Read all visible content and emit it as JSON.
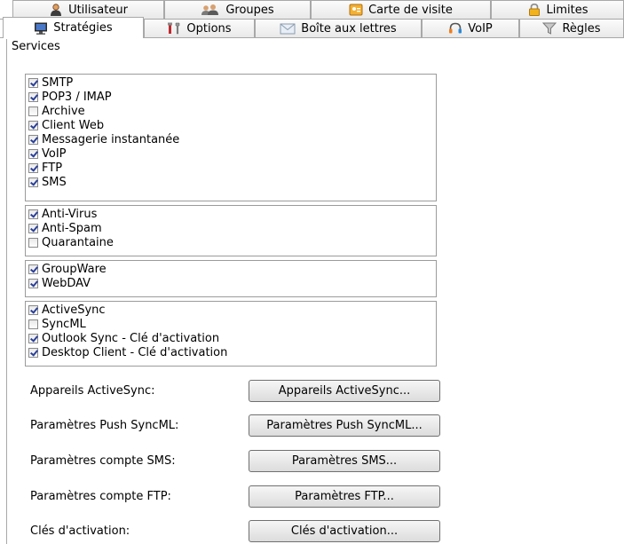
{
  "tabs_back": [
    {
      "label": "Utilisateur",
      "icon": "user-icon"
    },
    {
      "label": "Groupes",
      "icon": "groups-icon"
    },
    {
      "label": "Carte de visite",
      "icon": "business-card-icon"
    },
    {
      "label": "Limites",
      "icon": "lock-icon"
    }
  ],
  "tabs_front": [
    {
      "label": "Stratégies",
      "icon": "monitor-icon",
      "active": true
    },
    {
      "label": "Options",
      "icon": "tools-icon"
    },
    {
      "label": "Boîte aux lettres",
      "icon": "mail-icon"
    },
    {
      "label": "VoIP",
      "icon": "headset-icon"
    },
    {
      "label": "Règles",
      "icon": "filter-icon"
    }
  ],
  "services": {
    "label": "Services",
    "groups": [
      [
        {
          "label": "SMTP",
          "checked": true
        },
        {
          "label": "POP3 / IMAP",
          "checked": true
        },
        {
          "label": "Archive",
          "checked": false
        },
        {
          "label": "Client Web",
          "checked": true
        },
        {
          "label": "Messagerie instantanée",
          "checked": true
        },
        {
          "label": "VoIP",
          "checked": true
        },
        {
          "label": "FTP",
          "checked": true
        },
        {
          "label": "SMS",
          "checked": true
        }
      ],
      [
        {
          "label": "Anti-Virus",
          "checked": true
        },
        {
          "label": "Anti-Spam",
          "checked": true
        },
        {
          "label": "Quarantaine",
          "checked": false
        }
      ],
      [
        {
          "label": "GroupWare",
          "checked": true
        },
        {
          "label": "WebDAV",
          "checked": true
        }
      ],
      [
        {
          "label": "ActiveSync",
          "checked": true
        },
        {
          "label": "SyncML",
          "checked": false
        },
        {
          "label": "Outlook Sync - Clé d'activation",
          "checked": true
        },
        {
          "label": "Desktop Client - Clé d'activation",
          "checked": true
        }
      ]
    ]
  },
  "settings": [
    {
      "label": "Appareils ActiveSync:",
      "button": "Appareils ActiveSync..."
    },
    {
      "label": "Paramètres Push SyncML:",
      "button": "Paramètres Push SyncML..."
    },
    {
      "label": "Paramètres compte SMS:",
      "button": "Paramètres SMS..."
    },
    {
      "label": "Paramètres compte FTP:",
      "button": "Paramètres FTP..."
    },
    {
      "label": "Clés d'activation:",
      "button": "Clés d'activation..."
    }
  ]
}
